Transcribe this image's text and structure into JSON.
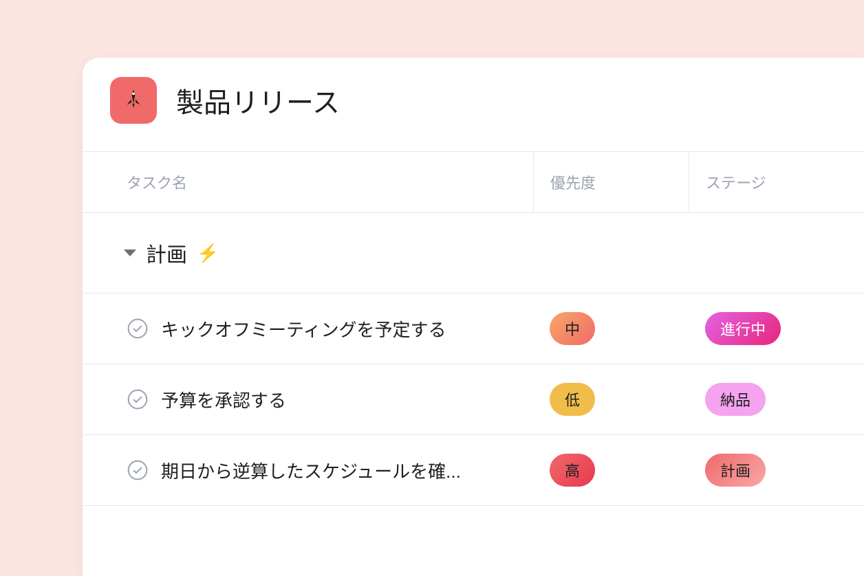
{
  "project": {
    "title": "製品リリース"
  },
  "columns": {
    "name": "タスク名",
    "priority": "優先度",
    "stage": "ステージ"
  },
  "section": {
    "title": "計画"
  },
  "tasks": [
    {
      "name": "キックオフミーティングを予定する",
      "priority": "中",
      "priority_class": "pill-medium",
      "stage": "進行中",
      "stage_class": "pill-progress"
    },
    {
      "name": "予算を承認する",
      "priority": "低",
      "priority_class": "pill-low",
      "stage": "納品",
      "stage_class": "pill-delivery"
    },
    {
      "name": "期日から逆算したスケジュールを確...",
      "priority": "高",
      "priority_class": "pill-high",
      "stage": "計画",
      "stage_class": "pill-planning"
    }
  ]
}
